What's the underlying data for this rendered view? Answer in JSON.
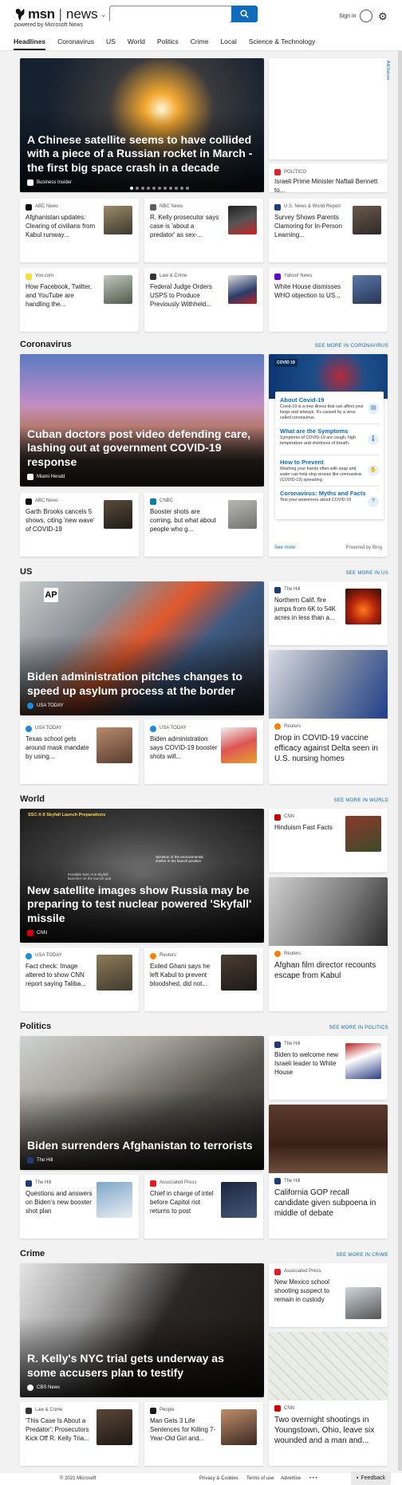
{
  "header": {
    "brand": "msn",
    "sep": "|",
    "product": "news",
    "powered": "powered by Microsoft News",
    "search_placeholder": "",
    "signin": "Sign in"
  },
  "nav": [
    "Headlines",
    "Coronavirus",
    "US",
    "World",
    "Politics",
    "Crime",
    "Local",
    "Science & Technology"
  ],
  "top": {
    "hero": {
      "title": "A Chinese satellite seems to have collided with a piece of a Russian rocket in March - the first big space crash in a decade",
      "source": "Business Insider"
    },
    "ad": {
      "label": "AdChoices"
    },
    "side1": {
      "source": "POLITICO",
      "title": "Israeli Prime Minister Naftali Bennett to..."
    },
    "row1": [
      {
        "source": "ABC News",
        "title": "Afghanistan updates: Clearing of civilians from Kabul runway..."
      },
      {
        "source": "NBC News",
        "title": "R. Kelly prosecutor says case is 'about a predator' as sex-..."
      },
      {
        "source": "U.S. News & World Report",
        "title": "Survey Shows Parents Clamoring for In-Person Learning..."
      }
    ],
    "row2": [
      {
        "source": "Vox.com",
        "title": "How Facebook, Twitter, and YouTube are handling the..."
      },
      {
        "source": "Law & Crime",
        "title": "Federal Judge Orders USPS to Produce Previously Withheld..."
      },
      {
        "source": "Yahoo! News",
        "title": "White House dismisses WHO objection to US..."
      }
    ]
  },
  "coronavirus": {
    "heading": "Coronavirus",
    "see_more": "SEE MORE IN CORONAVIRUS",
    "hero": {
      "title": "Cuban doctors post video defending care, lashing out at government COVID-19 response",
      "source": "Miami Herald"
    },
    "row": [
      {
        "source": "ABC News",
        "title": "Garth Brooks cancels 5 shows, citing 'new wave' of COVID-19"
      },
      {
        "source": "CNBC",
        "title": "Booster shots are coming, but what about people who g..."
      }
    ],
    "widget": {
      "tag": "COVID 19",
      "items": [
        {
          "h": "About Covid-19",
          "d": "Covid-19 is a new illness that can affect your lungs and airways. It's caused by a virus called coronavirus."
        },
        {
          "h": "What are the Symptoms",
          "d": "Symptoms of COVID-19 are cough, high temperature and shortness of breath."
        },
        {
          "h": "How to Prevent",
          "d": "Washing your hands often with soap and water can help stop viruses like coronavirus (COVID-19) spreading."
        },
        {
          "h": "Coronavirus: Myths and Facts",
          "d": "Test your awareness about COVID-19"
        }
      ],
      "see_more": "See more",
      "powered": "Powered by Bing"
    }
  },
  "us": {
    "heading": "US",
    "see_more": "SEE MORE IN US",
    "hero": {
      "title": "Biden administration pitches changes to speed up asylum process at the border",
      "source": "USA TODAY",
      "badge": "AP"
    },
    "side1": {
      "source": "The Hill",
      "title": "Northern Calif. fire jumps from 6K to 54K acres in less than a..."
    },
    "side2": {
      "source": "Reuters",
      "title": "Drop in COVID-19 vaccine efficacy against Delta seen in U.S. nursing homes"
    },
    "row": [
      {
        "source": "USA TODAY",
        "title": "Texas school gets around mask mandate by using..."
      },
      {
        "source": "USA TODAY",
        "title": "Biden administration says COVID-19 booster shots will..."
      }
    ]
  },
  "world": {
    "heading": "World",
    "see_more": "SEE MORE IN WORLD",
    "hero": {
      "title": "New satellite images show Russia may be preparing to test nuclear powered 'Skyfall' missile",
      "source": "CNN",
      "overlay": "SSC-X-9 Skyfall Launch Preparations",
      "note1": "Possible SSC-X-9 Skyfall launcher on the launch pad",
      "note2": "Skeleton of the environmental shelter in the launch position"
    },
    "side1": {
      "source": "CNN",
      "title": "Hinduism Fast Facts"
    },
    "side2": {
      "source": "Reuters",
      "title": "Afghan film director recounts escape from Kabul"
    },
    "row": [
      {
        "source": "USA TODAY",
        "title": "Fact check: Image altered to show CNN report saying Taliba..."
      },
      {
        "source": "Reuters",
        "title": "Exiled Ghani says he left Kabul to prevent bloodshed, did not..."
      }
    ]
  },
  "politics": {
    "heading": "Politics",
    "see_more": "SEE MORE IN POLITICS",
    "hero": {
      "title": "Biden surrenders Afghanistan to terrorists",
      "source": "The Hill"
    },
    "side1": {
      "source": "The Hill",
      "title": "Biden to welcome new Israeli leader to White House"
    },
    "side2": {
      "source": "The Hill",
      "title": "California GOP recall candidate given subpoena in middle of debate"
    },
    "row": [
      {
        "source": "The Hill",
        "title": "Questions and answers on Biden's new booster shot plan"
      },
      {
        "source": "Associated Press",
        "title": "Chief in charge of intel before Capitol riot returns to post"
      }
    ]
  },
  "crime": {
    "heading": "Crime",
    "see_more": "SEE MORE IN CRIME",
    "hero": {
      "title": "R. Kelly's NYC trial gets underway as some accusers plan to testify",
      "source": "CBS News"
    },
    "side1": {
      "source": "Associated Press",
      "title": "New Mexico school shooting suspect to remain in custody"
    },
    "side2": {
      "source": "CNN",
      "title": "Two overnight shootings in Youngstown, Ohio, leave six wounded and a man and..."
    },
    "row": [
      {
        "source": "Law & Crime",
        "title": "'This Case Is About a Predator': Prosecutors Kick Off R. Kelly Tria..."
      },
      {
        "source": "People",
        "title": "Man Gets 3 Life Sentences for Killing 7-Year-Old Girl and..."
      }
    ]
  },
  "footer": {
    "copyright": "© 2021 Microsoft",
    "privacy": "Privacy & Cookies",
    "terms": "Terms of use",
    "advertise": "Advertise",
    "more": "• • •",
    "feedback": "Feedback"
  }
}
